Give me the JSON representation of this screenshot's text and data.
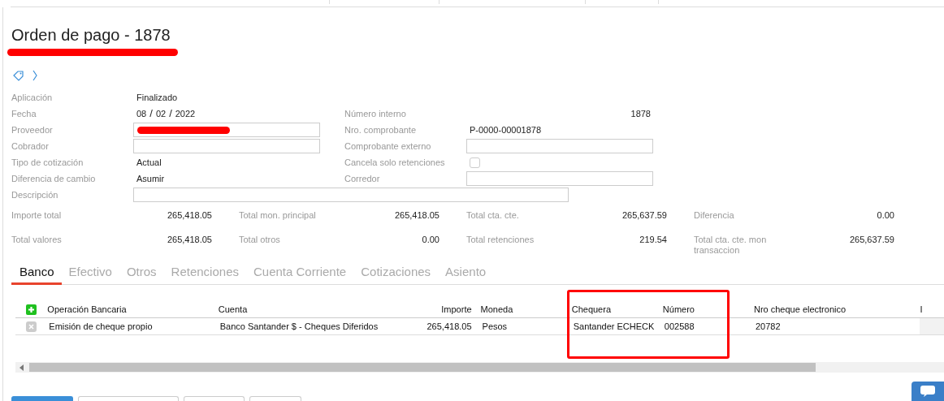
{
  "page": {
    "title": "Orden de pago - 1878"
  },
  "form_rows": [
    {
      "left": {
        "label": "Aplicación",
        "kind": "text",
        "value": "Finalizado"
      }
    },
    {
      "left": {
        "label": "Fecha",
        "kind": "date",
        "parts": [
          "08",
          "02",
          "2022"
        ],
        "separator": "/"
      },
      "right": {
        "label": "Número interno",
        "kind": "number",
        "value": "1878"
      }
    },
    {
      "left": {
        "label": "Proveedor",
        "kind": "redacted-input"
      },
      "right": {
        "label": "Nro. comprobante",
        "kind": "text",
        "value": "P-0000-00001878"
      }
    },
    {
      "left": {
        "label": "Cobrador",
        "kind": "input"
      },
      "right": {
        "label": "Comprobante externo",
        "kind": "input"
      }
    },
    {
      "left": {
        "label": "Tipo de cotización",
        "kind": "text",
        "value": "Actual"
      },
      "right": {
        "label": "Cancela solo retenciones",
        "kind": "checkbox",
        "checked": false
      }
    },
    {
      "left": {
        "label": "Diferencia de cambio",
        "kind": "text",
        "value": "Asumir"
      },
      "right": {
        "label": "Corredor",
        "kind": "input"
      }
    },
    {
      "left": {
        "label": "Descripción",
        "kind": "wide-input"
      }
    }
  ],
  "totals": [
    [
      {
        "label": "Importe total",
        "value": "265,418.05"
      },
      {
        "label": "Total mon. principal",
        "value": "265,418.05"
      },
      {
        "label": "Total cta. cte.",
        "value": "265,637.59"
      },
      {
        "label": "Diferencia",
        "value": "0.00"
      }
    ],
    [
      {
        "label": "Total valores",
        "value": "265,418.05"
      },
      {
        "label": "Total otros",
        "value": "0.00"
      },
      {
        "label": "Total retenciones",
        "value": "219.54"
      },
      {
        "label": "Total cta. cte. mon transaccion",
        "value": "265,637.59"
      }
    ]
  ],
  "tabs": [
    {
      "label": "Banco",
      "selected": true
    },
    {
      "label": "Efectivo",
      "selected": false
    },
    {
      "label": "Otros",
      "selected": false
    },
    {
      "label": "Retenciones",
      "selected": false
    },
    {
      "label": "Cuenta Corriente",
      "selected": false
    },
    {
      "label": "Cotizaciones",
      "selected": false
    },
    {
      "label": "Asiento",
      "selected": false
    }
  ],
  "table": {
    "columns": [
      {
        "label": "Operación Bancaria",
        "kind": "text"
      },
      {
        "label": "Cuenta",
        "kind": "text"
      },
      {
        "label": "Importe",
        "kind": "amount"
      },
      {
        "label": "Moneda",
        "kind": "text"
      },
      {
        "label": "Chequera",
        "kind": "text"
      },
      {
        "label": "Número",
        "kind": "text"
      },
      {
        "label": "Nro cheque electronico",
        "kind": "text"
      },
      {
        "label": "I",
        "kind": "text"
      }
    ],
    "rows": [
      [
        "Emisión de cheque propio",
        "Banco Santander $ - Cheques Diferidos",
        "265,418.05",
        "Pesos",
        "Santander ECHECK",
        "002588",
        "20782",
        ""
      ]
    ]
  }
}
